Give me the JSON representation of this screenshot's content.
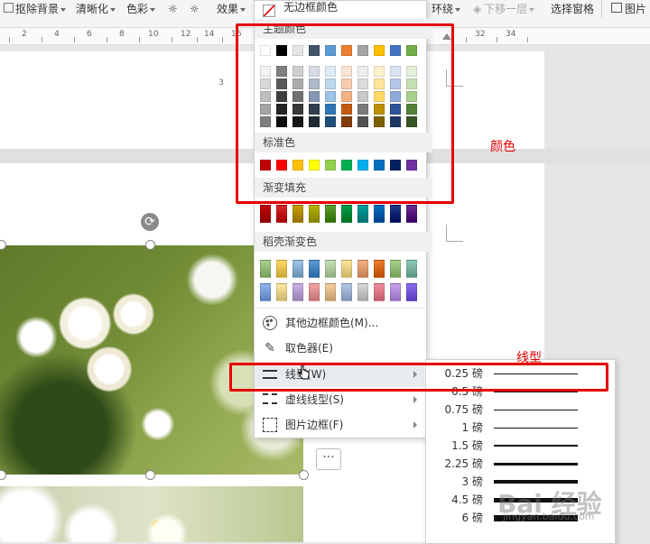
{
  "toolbar": {
    "items": [
      {
        "label": "抠除背景",
        "caret": true
      },
      {
        "label": "清晰化",
        "caret": true
      },
      {
        "label": "色彩",
        "caret": true
      },
      {
        "label": "效果",
        "caret": true
      },
      {
        "label": "环绕",
        "caret": true
      },
      {
        "label": "下移一层",
        "caret": true
      },
      {
        "label": "选择窗格",
        "caret": false
      },
      {
        "label": "图片",
        "caret": false
      }
    ]
  },
  "ruler": {
    "ticks": [
      "2",
      "4",
      "6",
      "8",
      "10",
      "12",
      "14",
      "16",
      "32",
      "34"
    ]
  },
  "page_number_mark": "3",
  "dropdown": {
    "no_border_color": "无边框颜色",
    "theme_colors_label": "主题颜色",
    "standard_colors_label": "标准色",
    "gradient_fill_label": "渐变填充",
    "daoke_gradient_label": "稻壳渐变色",
    "theme_top_row": [
      "#ffffff",
      "#000000",
      "#e7e6e6",
      "#44546a",
      "#5b9bd5",
      "#ed7d31",
      "#a5a5a5",
      "#ffc000",
      "#4472c4",
      "#70ad47"
    ],
    "theme_shades": [
      [
        "#f2f2f2",
        "#7f7f7f",
        "#d0cece",
        "#d6dce4",
        "#deebf6",
        "#fbe5d5",
        "#ededed",
        "#fff2cc",
        "#dae3f3",
        "#e2efd9"
      ],
      [
        "#d8d8d8",
        "#595959",
        "#aeabab",
        "#adb9ca",
        "#bdd7ee",
        "#f7cbac",
        "#dbdbdb",
        "#fee599",
        "#b4c6e7",
        "#c5e0b3"
      ],
      [
        "#bfbfbf",
        "#3f3f3f",
        "#757070",
        "#8496b0",
        "#9dc3e6",
        "#f4b183",
        "#c9c9c9",
        "#ffd965",
        "#8eaadb",
        "#a8d08d"
      ],
      [
        "#a5a5a5",
        "#262626",
        "#3a3838",
        "#323f4f",
        "#2e75b5",
        "#c55a11",
        "#7b7b7b",
        "#bf9000",
        "#2f5496",
        "#538135"
      ],
      [
        "#7f7f7f",
        "#0c0c0c",
        "#161616",
        "#222a35",
        "#1e4e79",
        "#833c0b",
        "#525252",
        "#7f6000",
        "#1f3864",
        "#375623"
      ]
    ],
    "standard_colors": [
      "#c00000",
      "#ff0000",
      "#ffc000",
      "#ffff00",
      "#92d050",
      "#00b050",
      "#00b0f0",
      "#0070c0",
      "#002060",
      "#7030a0"
    ],
    "gradient_colors": [
      "#c00000",
      "#d9272b",
      "#c8a000",
      "#b5b400",
      "#5c9e2f",
      "#00a050",
      "#00a0a0",
      "#0070c0",
      "#1f3a8a",
      "#6a2c91"
    ],
    "daoke_row1": [
      "#a9d18e",
      "#ffd966",
      "#9dc3e6",
      "#5b9bd5",
      "#c5e0b4",
      "#ffe699",
      "#f4b183",
      "#ed7d31",
      "#a9d18e",
      "#8fc9b6"
    ],
    "daoke_row2": [
      "#8fb4f0",
      "#ffe9a0",
      "#c9b2e6",
      "#f4a6a6",
      "#f7d0a0",
      "#b4c7e7",
      "#d9d9d9",
      "#f28e9e",
      "#c8a2f0",
      "#8a6cf0"
    ],
    "other_colors": "其他边框颜色(M)...",
    "eyedropper": "取色器(E)",
    "line_type": "线型(W)",
    "dash_type": "虚线线型(S)",
    "picture_border": "图片边框(F)"
  },
  "submenu": {
    "weights": [
      {
        "label": "0.25 磅",
        "thickness": 0.25
      },
      {
        "label": "0.5 磅",
        "thickness": 0.5
      },
      {
        "label": "0.75 磅",
        "thickness": 0.75
      },
      {
        "label": "1 磅",
        "thickness": 1
      },
      {
        "label": "1.5 磅",
        "thickness": 1.5
      },
      {
        "label": "2.25 磅",
        "thickness": 2.25
      },
      {
        "label": "3 磅",
        "thickness": 3
      },
      {
        "label": "4.5 磅",
        "thickness": 4.5
      },
      {
        "label": "6 磅",
        "thickness": 6
      }
    ]
  },
  "annotations": {
    "color_label": "颜色",
    "line_label": "线型",
    "box_color": "#e60000"
  },
  "watermark": {
    "text": "Bai 经验",
    "url": "jingyan.baidu.com"
  },
  "more_button": "···"
}
